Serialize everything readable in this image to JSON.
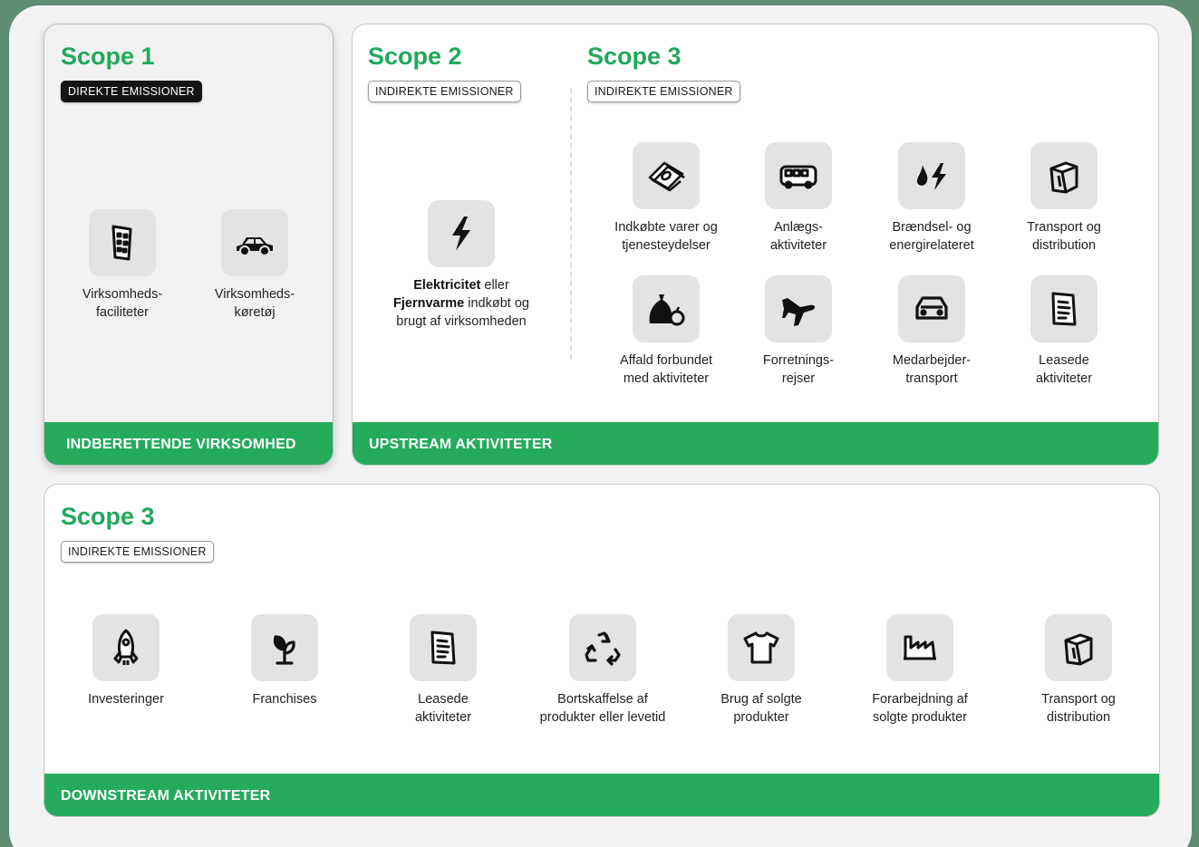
{
  "scope1": {
    "title": "Scope 1",
    "badge": "DIREKTE EMISSIONER",
    "footer": "INDBERETTENDE VIRKSOMHED",
    "items": [
      {
        "label": "Virksomheds-\nfaciliteter",
        "icon": "building-icon"
      },
      {
        "label": "Virksomheds-\nkøretøj",
        "icon": "car-icon"
      }
    ]
  },
  "upstream": {
    "footer": "UPSTREAM AKTIVITETER",
    "scope2": {
      "title": "Scope 2",
      "badge": "INDIREKTE EMISSIONER",
      "item": {
        "icon": "lightning-icon",
        "bold1": "Elektricitet",
        "text1": " eller",
        "bold2": "Fjernvarme",
        "text2": " indkøbt og",
        "text3": "brugt af virksomheden"
      }
    },
    "scope3": {
      "title": "Scope 3",
      "badge": "INDIREKTE EMISSIONER",
      "items": [
        {
          "label": "Indkøbte varer og\ntjenesteydelser",
          "icon": "money-icon"
        },
        {
          "label": "Anlægs-\naktiviteter",
          "icon": "bus-icon"
        },
        {
          "label": "Brændsel- og\nenergirelateret",
          "icon": "fuel-energy-icon"
        },
        {
          "label": "Transport og\ndistribution",
          "icon": "box-icon"
        },
        {
          "label": "Affald forbundet\nmed aktiviteter",
          "icon": "garbage-bag-icon"
        },
        {
          "label": "Forretnings-\nrejser",
          "icon": "airplane-icon"
        },
        {
          "label": "Medarbejder-\ntransport",
          "icon": "car-front-icon"
        },
        {
          "label": "Leasede\naktiviteter",
          "icon": "document-icon"
        }
      ]
    }
  },
  "downstream": {
    "title": "Scope 3",
    "badge": "INDIREKTE EMISSIONER",
    "footer": "DOWNSTREAM AKTIVITETER",
    "items": [
      {
        "label": "Investeringer",
        "icon": "rocket-icon"
      },
      {
        "label": "Franchises",
        "icon": "plant-icon"
      },
      {
        "label": "Leasede\naktiviteter",
        "icon": "document-icon"
      },
      {
        "label": "Bortskaffelse af\nprodukter eller levetid",
        "icon": "recycle-icon"
      },
      {
        "label": "Brug af solgte\nprodukter",
        "icon": "tshirt-icon"
      },
      {
        "label": "Forarbejdning af\nsolgte produkter",
        "icon": "factory-icon"
      },
      {
        "label": "Transport og\ndistribution",
        "icon": "box-icon"
      }
    ]
  }
}
